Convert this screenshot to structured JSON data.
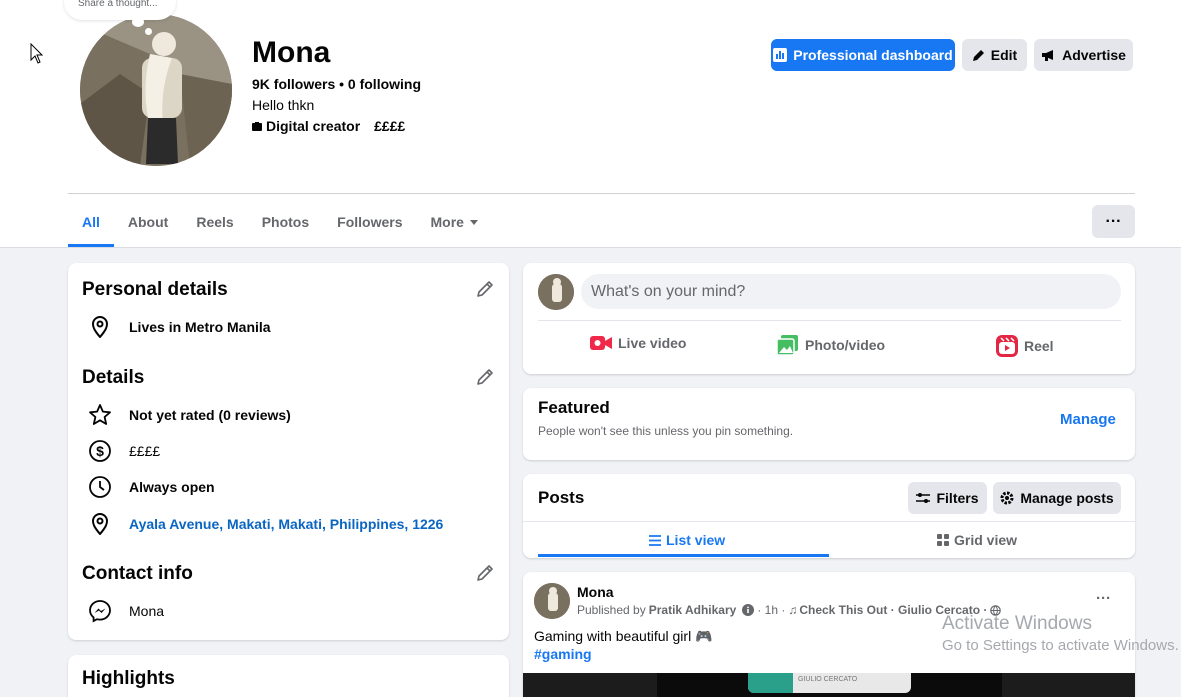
{
  "profile": {
    "bubble_text": "Share a thought...",
    "name": "Mona",
    "follow_stats": "9K followers • 0 following",
    "bio": "Hello thkn",
    "category": "Digital creator",
    "price_range": "££££"
  },
  "header_buttons": {
    "dashboard": "Professional dashboard",
    "edit": "Edit",
    "advertise": "Advertise"
  },
  "tabs": [
    {
      "label": "All",
      "active": true
    },
    {
      "label": "About"
    },
    {
      "label": "Reels"
    },
    {
      "label": "Photos"
    },
    {
      "label": "Followers"
    },
    {
      "label": "More"
    }
  ],
  "tabs_more_button": "···",
  "personal_details": {
    "title": "Personal details",
    "lives_in": "Lives in Metro Manila"
  },
  "details": {
    "title": "Details",
    "rating": "Not yet rated (0 reviews)",
    "price": "££££",
    "hours": "Always open",
    "address": "Ayala Avenue, Makati, Makati, Philippines, 1226"
  },
  "contact_info": {
    "title": "Contact info",
    "messenger": "Mona"
  },
  "highlights": {
    "title": "Highlights"
  },
  "composer": {
    "placeholder": "What's on your mind?",
    "live_video": "Live video",
    "photo_video": "Photo/video",
    "reel": "Reel"
  },
  "featured": {
    "title": "Featured",
    "subtitle": "People won't see this unless you pin something.",
    "manage": "Manage"
  },
  "posts": {
    "title": "Posts",
    "filters": "Filters",
    "manage_posts": "Manage posts",
    "list_view": "List view",
    "grid_view": "Grid view"
  },
  "post": {
    "author": "Mona",
    "published_by_prefix": "Published by ",
    "publisher": "Pratik Adhikary",
    "meta": "· 1h · ",
    "music": "Check This Out · Giulio Cercato ·",
    "text": "Gaming with beautiful girl 🎮",
    "hashtag": "#gaming",
    "media_caption": "GIULIO CERCATO",
    "more_button": "···"
  },
  "watermark": {
    "line1": "Activate Windows",
    "line2": "Go to Settings to activate Windows."
  },
  "colors": {
    "accent": "#1877f2",
    "link": "#0a66c2",
    "live_red": "#f02849",
    "photo_green": "#45bd62",
    "reel_pink": "#e42645"
  }
}
